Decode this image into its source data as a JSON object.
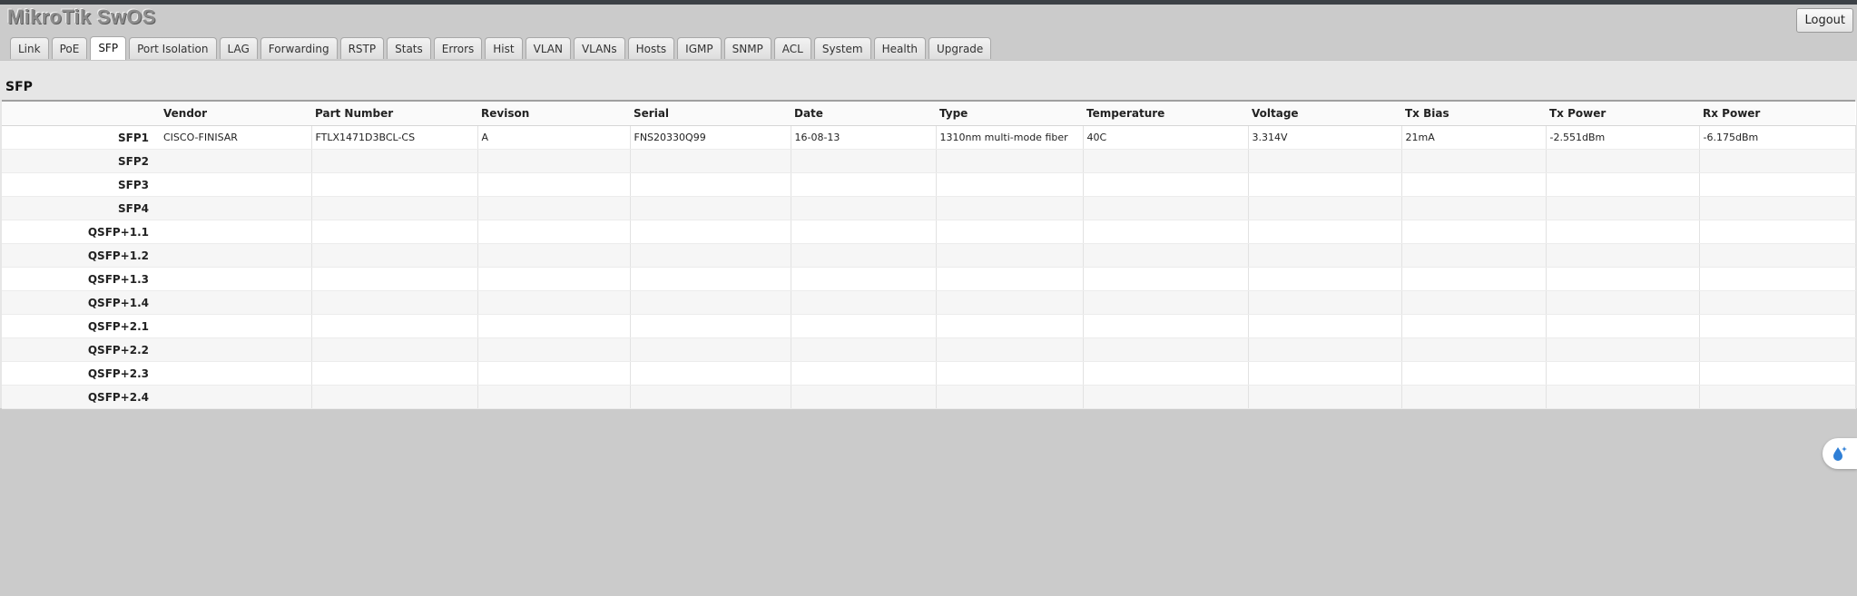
{
  "app": {
    "title": "MikroTik SwOS",
    "logout_label": "Logout"
  },
  "tabs": [
    {
      "label": "Link"
    },
    {
      "label": "PoE"
    },
    {
      "label": "SFP",
      "active": true
    },
    {
      "label": "Port Isolation"
    },
    {
      "label": "LAG"
    },
    {
      "label": "Forwarding"
    },
    {
      "label": "RSTP"
    },
    {
      "label": "Stats"
    },
    {
      "label": "Errors"
    },
    {
      "label": "Hist"
    },
    {
      "label": "VLAN"
    },
    {
      "label": "VLANs"
    },
    {
      "label": "Hosts"
    },
    {
      "label": "IGMP"
    },
    {
      "label": "SNMP"
    },
    {
      "label": "ACL"
    },
    {
      "label": "System"
    },
    {
      "label": "Health"
    },
    {
      "label": "Upgrade"
    }
  ],
  "section": {
    "title": "SFP"
  },
  "table": {
    "columns": [
      "",
      "Vendor",
      "Part Number",
      "Revison",
      "Serial",
      "Date",
      "Type",
      "Temperature",
      "Voltage",
      "Tx Bias",
      "Tx Power",
      "Rx Power"
    ],
    "rows": [
      [
        "SFP1",
        "CISCO-FINISAR",
        "FTLX1471D3BCL-CS",
        "A",
        "FNS20330Q99",
        "16-08-13",
        "1310nm multi-mode fiber",
        "40C",
        "3.314V",
        "21mA",
        "-2.551dBm",
        "-6.175dBm"
      ],
      [
        "SFP2",
        "",
        "",
        "",
        "",
        "",
        "",
        "",
        "",
        "",
        "",
        ""
      ],
      [
        "SFP3",
        "",
        "",
        "",
        "",
        "",
        "",
        "",
        "",
        "",
        "",
        ""
      ],
      [
        "SFP4",
        "",
        "",
        "",
        "",
        "",
        "",
        "",
        "",
        "",
        "",
        ""
      ],
      [
        "QSFP+1.1",
        "",
        "",
        "",
        "",
        "",
        "",
        "",
        "",
        "",
        "",
        ""
      ],
      [
        "QSFP+1.2",
        "",
        "",
        "",
        "",
        "",
        "",
        "",
        "",
        "",
        "",
        ""
      ],
      [
        "QSFP+1.3",
        "",
        "",
        "",
        "",
        "",
        "",
        "",
        "",
        "",
        "",
        ""
      ],
      [
        "QSFP+1.4",
        "",
        "",
        "",
        "",
        "",
        "",
        "",
        "",
        "",
        "",
        ""
      ],
      [
        "QSFP+2.1",
        "",
        "",
        "",
        "",
        "",
        "",
        "",
        "",
        "",
        "",
        ""
      ],
      [
        "QSFP+2.2",
        "",
        "",
        "",
        "",
        "",
        "",
        "",
        "",
        "",
        "",
        ""
      ],
      [
        "QSFP+2.3",
        "",
        "",
        "",
        "",
        "",
        "",
        "",
        "",
        "",
        "",
        ""
      ],
      [
        "QSFP+2.4",
        "",
        "",
        "",
        "",
        "",
        "",
        "",
        "",
        "",
        "",
        ""
      ]
    ]
  },
  "floating_button": {
    "icon": "water-drop-sparkle-icon",
    "color": "#2f7fd6"
  }
}
